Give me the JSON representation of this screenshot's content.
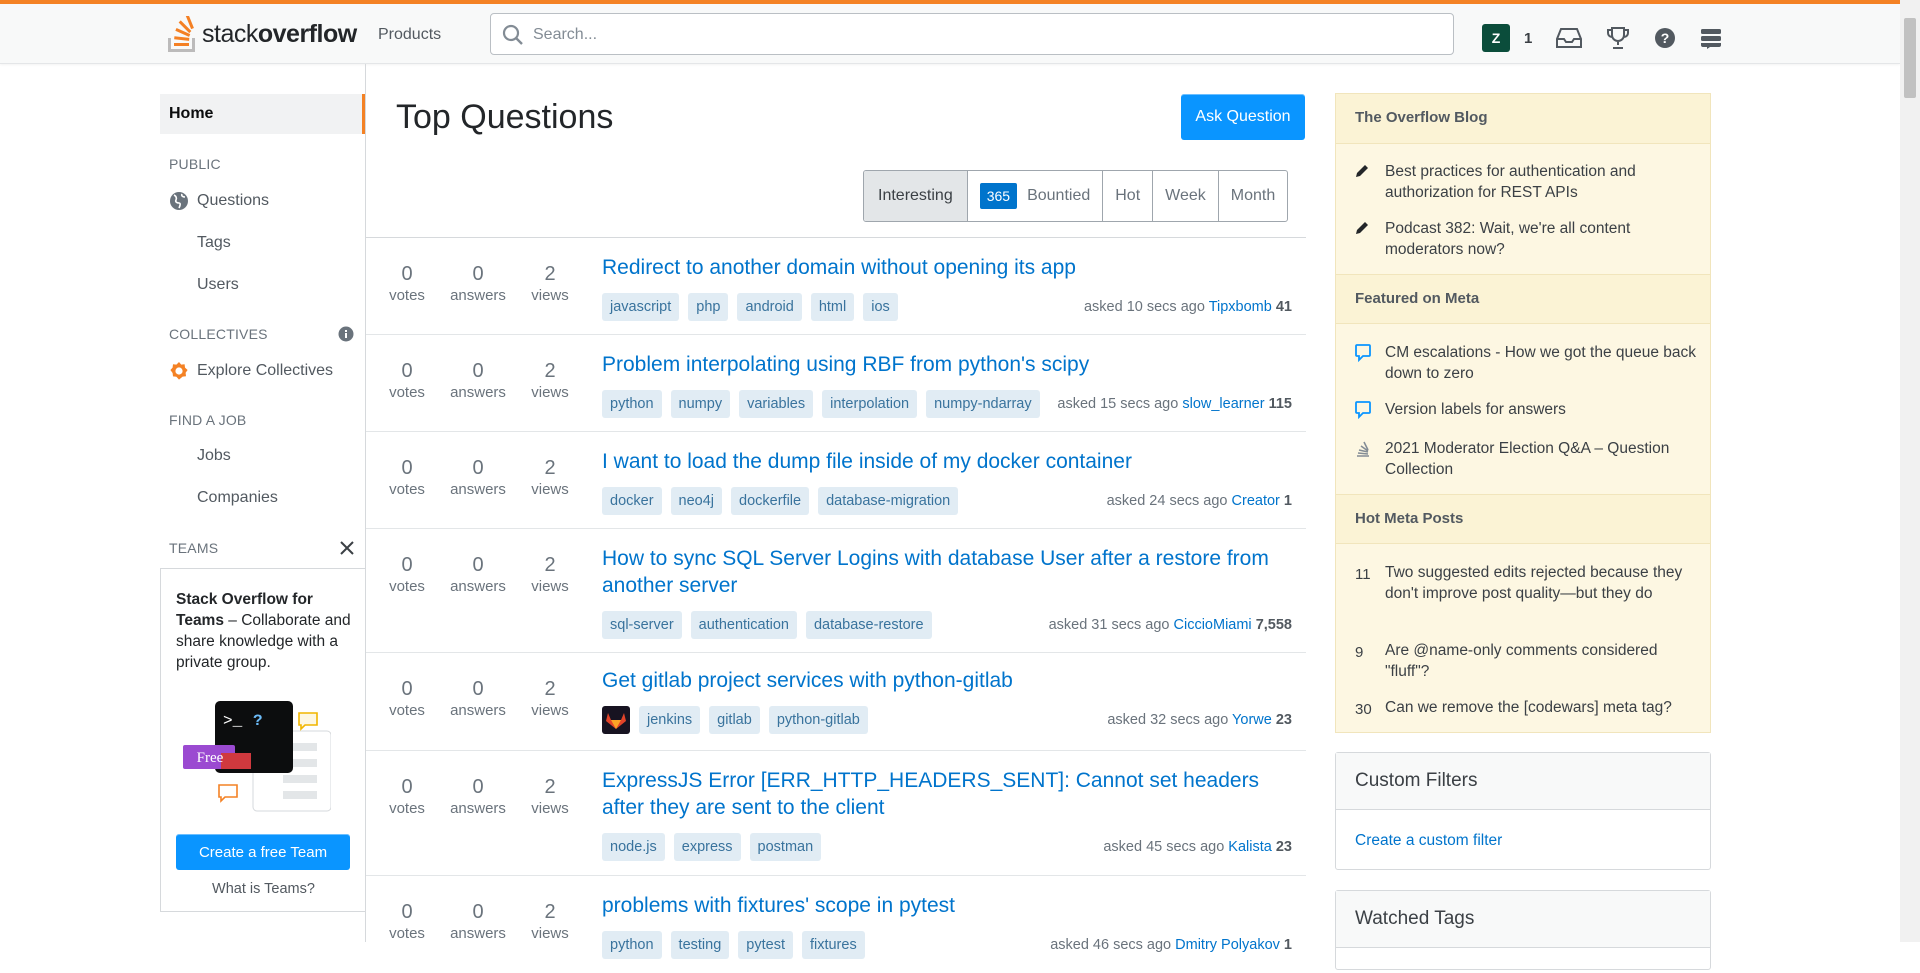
{
  "header": {
    "logo_plain": "stack",
    "logo_bold": "overflow",
    "products_label": "Products",
    "search_placeholder": "Search...",
    "avatar_letter": "Z",
    "reputation": "1"
  },
  "leftnav": {
    "home": "Home",
    "public_heading": "PUBLIC",
    "questions": "Questions",
    "tags": "Tags",
    "users": "Users",
    "collectives_heading": "COLLECTIVES",
    "explore_collectives": "Explore Collectives",
    "job_heading": "FIND A JOB",
    "jobs": "Jobs",
    "companies": "Companies",
    "teams_heading": "TEAMS",
    "teams_bold": "Stack Overflow for Teams",
    "teams_text": " – Collaborate and share knowledge with a private group.",
    "free_badge": "Free",
    "create_team_button": "Create a free Team",
    "what_is_teams": "What is Teams?"
  },
  "main": {
    "title": "Top Questions",
    "ask_button": "Ask Question",
    "filters": {
      "interesting": "Interesting",
      "bountied_count": "365",
      "bountied": "Bountied",
      "hot": "Hot",
      "week": "Week",
      "month": "Month"
    },
    "stat_labels": {
      "votes": "votes",
      "answers": "answers",
      "views": "views"
    },
    "questions": [
      {
        "votes": "0",
        "answers": "0",
        "views": "2",
        "title": "Redirect to another domain without opening its app",
        "tags": [
          "javascript",
          "php",
          "android",
          "html",
          "ios"
        ],
        "asked": "asked 10 secs ago",
        "user": "Tipxbomb",
        "rep": "41"
      },
      {
        "votes": "0",
        "answers": "0",
        "views": "2",
        "title": "Problem interpolating using RBF from python's scipy",
        "tags": [
          "python",
          "numpy",
          "variables",
          "interpolation",
          "numpy-ndarray"
        ],
        "asked": "asked 15 secs ago",
        "user": "slow_learner",
        "rep": "115"
      },
      {
        "votes": "0",
        "answers": "0",
        "views": "2",
        "title": "I want to load the dump file inside of my docker container",
        "tags": [
          "docker",
          "neo4j",
          "dockerfile",
          "database-migration"
        ],
        "asked": "asked 24 secs ago",
        "user": "Creator",
        "rep": "1"
      },
      {
        "votes": "0",
        "answers": "0",
        "views": "2",
        "title": "How to sync SQL Server Logins with database User after a restore from another server",
        "tags": [
          "sql-server",
          "authentication",
          "database-restore"
        ],
        "asked": "asked 31 secs ago",
        "user": "CiccioMiami",
        "rep": "7,558"
      },
      {
        "votes": "0",
        "answers": "0",
        "views": "2",
        "title": "Get gitlab project services with python-gitlab",
        "tags": [
          "jenkins",
          "gitlab",
          "python-gitlab"
        ],
        "asked": "asked 32 secs ago",
        "user": "Yorwe",
        "rep": "23"
      },
      {
        "votes": "0",
        "answers": "0",
        "views": "2",
        "title": "ExpressJS Error [ERR_HTTP_HEADERS_SENT]: Cannot set headers after they are sent to the client",
        "tags": [
          "node.js",
          "express",
          "postman"
        ],
        "asked": "asked 45 secs ago",
        "user": "Kalista",
        "rep": "23"
      },
      {
        "votes": "0",
        "answers": "0",
        "views": "2",
        "title": "problems with fixtures' scope in pytest",
        "tags": [
          "python",
          "testing",
          "pytest",
          "fixtures"
        ],
        "asked": "asked 46 secs ago",
        "user": "Dmitry Polyakov",
        "rep": "1"
      }
    ]
  },
  "sidebar": {
    "blog_heading": "The Overflow Blog",
    "blog_items": [
      "Best practices for authentication and authorization for REST APIs",
      "Podcast 382: Wait, we're all content moderators now?"
    ],
    "meta_heading": "Featured on Meta",
    "meta_items": [
      "CM escalations - How we got the queue back down to zero",
      "Version labels for answers",
      "2021 Moderator Election Q&A – Question Collection"
    ],
    "hot_heading": "Hot Meta Posts",
    "hot_items": [
      {
        "count": "11",
        "text": "Two suggested edits rejected because they don't improve post quality—but they do"
      },
      {
        "count": "9",
        "text": "Are @name-only comments considered \"fluff\"?"
      },
      {
        "count": "30",
        "text": "Can we remove the [codewars] meta tag?"
      }
    ],
    "custom_filters_heading": "Custom Filters",
    "create_filter_link": "Create a custom filter",
    "watched_tags_heading": "Watched Tags"
  }
}
